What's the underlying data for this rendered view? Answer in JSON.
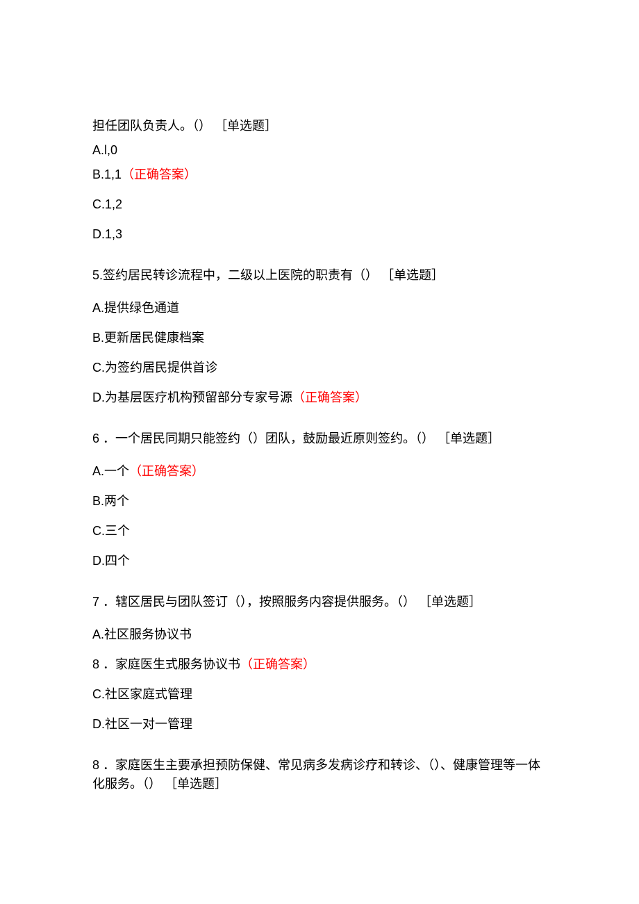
{
  "correct_label": "（正确答案）",
  "q4": {
    "stem_line1": "担任团队负责人。（） ［单选题］",
    "optA": "A.l,0",
    "optB": "B.1,1",
    "optC": "C.1,2",
    "optD": "D.1,3"
  },
  "q5": {
    "stem": "5.签约居民转诊流程中，二级以上医院的职责有（） ［单选题］",
    "optA": "A.提供绿色通道",
    "optB": "B.更新居民健康档案",
    "optC": "C.为签约居民提供首诊",
    "optD": "D.为基层医疗机构预留部分专家号源"
  },
  "q6": {
    "stem": "6 ．一个居民同期只能签约（）团队，鼓励最近原则签约。（） ［单选题］",
    "optA": "A.一个",
    "optB": "B.两个",
    "optC": "C.三个",
    "optD": "D.四个"
  },
  "q7": {
    "stem": "7 ．辖区居民与团队签订（），按照服务内容提供服务。（） ［单选题］",
    "optA": "A.社区服务协议书",
    "optB": "8 ．家庭医生式服务协议书",
    "optC": "C.社区家庭式管理",
    "optD": "D.社区一对一管理"
  },
  "q8": {
    "stem": "8 ．家庭医生主要承担预防保健、常见病多发病诊疗和转诊、（）、健康管理等一体化服务。（） ［单选题］"
  }
}
